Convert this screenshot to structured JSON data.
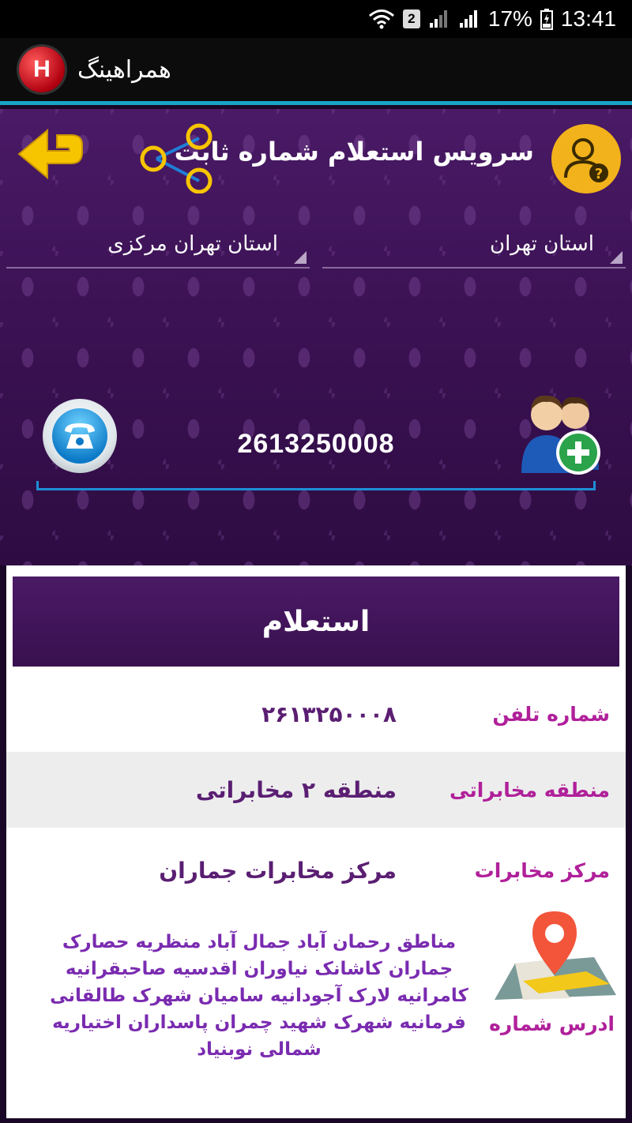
{
  "status_bar": {
    "sim_slot": "2",
    "battery": "17%",
    "time": "13:41"
  },
  "app_bar": {
    "logo_letter": "H",
    "title": "همراهینگ"
  },
  "header": {
    "title": "سرویس استعلام شماره ثابت"
  },
  "dropdowns": {
    "province": "استان تهران",
    "region": "استان تهران مرکزی"
  },
  "phone_input": {
    "value": "2613250008"
  },
  "result": {
    "header": "استعلام",
    "rows": [
      {
        "label": "شماره تلفن",
        "value": "۲۶۱۳۲۵۰۰۰۸"
      },
      {
        "label": "منطقه مخابراتی",
        "value": "منطقه ۲ مخابراتی"
      },
      {
        "label": "مرکز مخابرات",
        "value": "مرکز مخابرات جماران"
      }
    ],
    "address_label": "ادرس شماره",
    "address_text": "مناطق رحمان آباد جمال آباد  منظریه  حصارک جماران  کاشانک  نیاوران اقدسیه صاحبقرانیه کامرانیه لارک  آجودانیه  سامیان شهرک طالقانی فرمانیه  شهرک شهید چمران  پاسداران  اختیاریه شمالی  نوبنیاد"
  },
  "colors": {
    "accent_blue": "#1aa3c8",
    "label_magenta": "#b0209a",
    "value_purple": "#5a1e72",
    "icon_yellow": "#f2b21b"
  }
}
